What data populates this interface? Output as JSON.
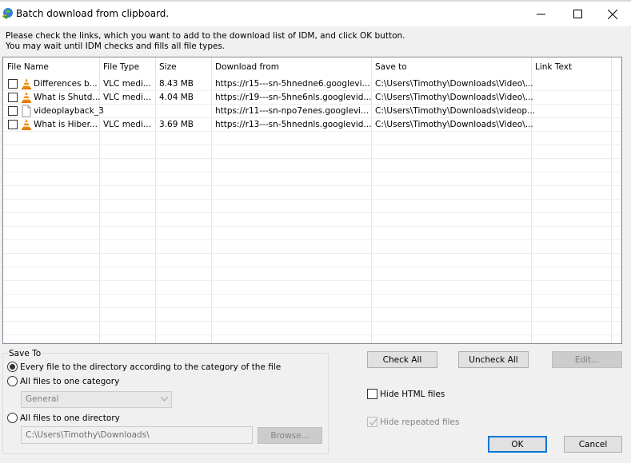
{
  "window": {
    "title": "Batch download from clipboard.",
    "icon": "idm-globe-icon",
    "controls": [
      "minimize",
      "maximize",
      "close"
    ]
  },
  "instructions": {
    "line1": "Please check the links, which you want to add to the download list of IDM, and click OK button.",
    "line2": "You may wait until IDM checks and fills all file types."
  },
  "table": {
    "columns": [
      "File Name",
      "File Type",
      "Size",
      "Download from",
      "Save to",
      "Link Text"
    ],
    "rows": [
      {
        "checked": false,
        "icon": "vlc-cone-icon",
        "file_name": "Differences b...",
        "file_type": "VLC medi...",
        "size": "8.43  MB",
        "download_from": "https://r15---sn-5hnedne6.googlevi...",
        "save_to": "C:\\Users\\Timothy\\Downloads\\Video\\...",
        "link_text": ""
      },
      {
        "checked": false,
        "icon": "vlc-cone-icon",
        "file_name": "What is Shutd...",
        "file_type": "VLC medi...",
        "size": "4.04  MB",
        "download_from": "https://r19---sn-5hne6nls.googlevid...",
        "save_to": "C:\\Users\\Timothy\\Downloads\\Video\\...",
        "link_text": ""
      },
      {
        "checked": false,
        "icon": "blank-file-icon",
        "file_name": "videoplayback_3",
        "file_type": "",
        "size": "",
        "download_from": "https://r11---sn-npo7enes.googlevi...",
        "save_to": "C:\\Users\\Timothy\\Downloads\\videop...",
        "link_text": ""
      },
      {
        "checked": false,
        "icon": "vlc-cone-icon",
        "file_name": "What is Hiber...",
        "file_type": "VLC medi...",
        "size": "3.69  MB",
        "download_from": "https://r13---sn-5hnednls.googlevid...",
        "save_to": "C:\\Users\\Timothy\\Downloads\\Video\\...",
        "link_text": ""
      }
    ]
  },
  "save_to": {
    "legend": "Save To",
    "options": [
      {
        "label": "Every file to the directory according to the category of the file",
        "selected": true
      },
      {
        "label": "All files to one category",
        "selected": false
      },
      {
        "label": "All files to one directory",
        "selected": false
      }
    ],
    "category_value": "General",
    "directory_value": "C:\\Users\\Timothy\\Downloads\\",
    "browse_label": "Browse..."
  },
  "buttons": {
    "check_all": "Check All",
    "uncheck_all": "Uncheck All",
    "edit": "Edit...",
    "ok": "OK",
    "cancel": "Cancel"
  },
  "options": {
    "hide_html": {
      "label": "Hide HTML files",
      "checked": false
    },
    "hide_repeated": {
      "label": "Hide repeated files",
      "checked": true,
      "disabled": true
    }
  }
}
